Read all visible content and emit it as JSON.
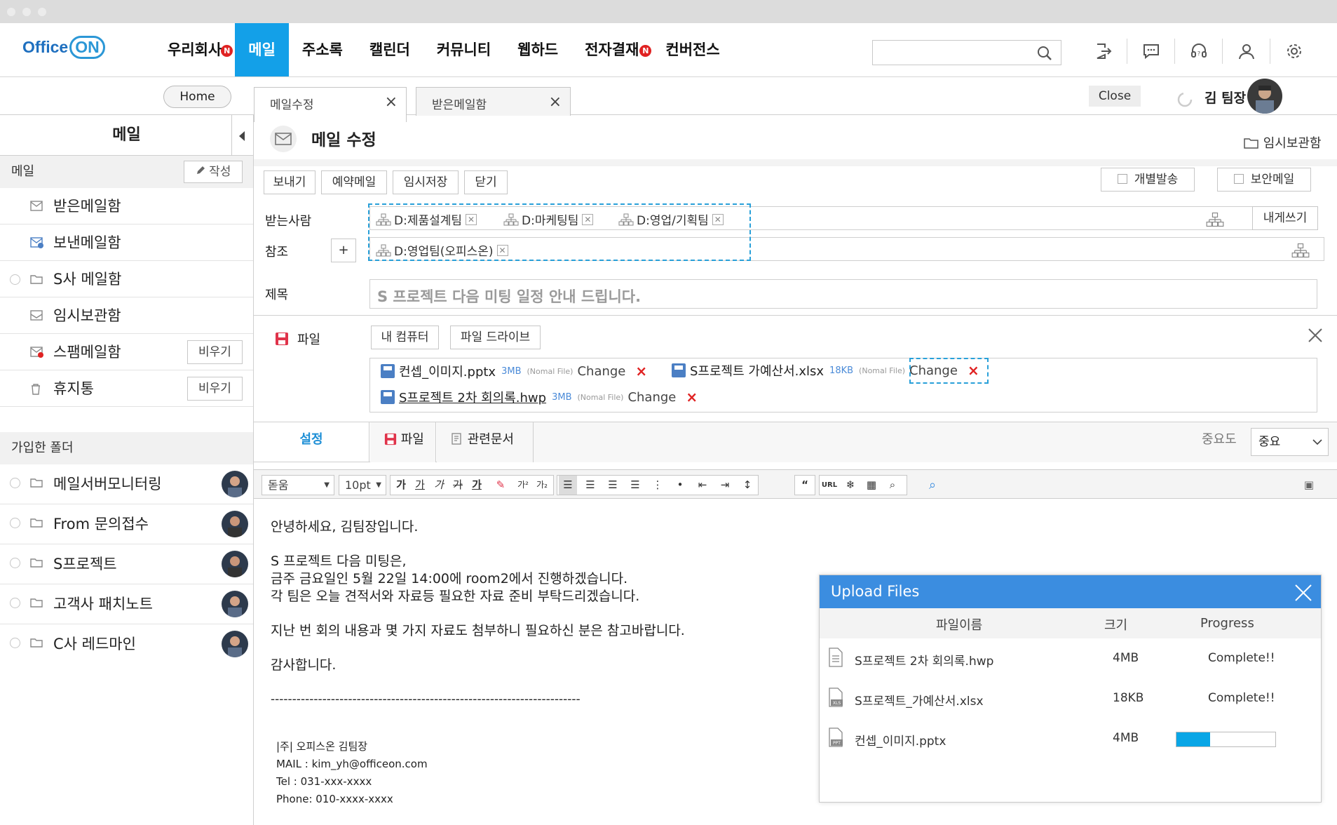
{
  "app": {
    "logo_text": "Office",
    "logo_on": "ON",
    "menu": [
      {
        "label": "우리회사",
        "badge": "N"
      },
      {
        "label": "메일",
        "active": true
      },
      {
        "label": "주소록"
      },
      {
        "label": "캘린더"
      },
      {
        "label": "커뮤니티"
      },
      {
        "label": "웹하드"
      },
      {
        "label": "전자결재",
        "badge": "N"
      },
      {
        "label": "컨버전스"
      }
    ],
    "search_placeholder": "",
    "accent_color": "#13a0e8"
  },
  "subbar": {
    "home_label": "Home",
    "tabs": [
      {
        "label": "메일수정",
        "close": "×"
      },
      {
        "label": "받은메일함",
        "close": "×"
      }
    ],
    "close_label": "Close",
    "username": "김 팀장"
  },
  "sidebar": {
    "title": "메일",
    "section_mail": "메일",
    "write_label": "작성",
    "items": [
      {
        "label": "받은메일함"
      },
      {
        "label": "보낸메일함"
      },
      {
        "label": "S사 메일함"
      },
      {
        "label": "임시보관함"
      },
      {
        "label": "스팸메일함",
        "action": "비우기"
      },
      {
        "label": "휴지통",
        "action": "비우기"
      }
    ],
    "section_joined": "가입한 폴더",
    "joined": [
      {
        "label": "메일서버모니터링"
      },
      {
        "label": "From 문의접수"
      },
      {
        "label": "S프로젝트"
      },
      {
        "label": "고객사 패치노트"
      },
      {
        "label": "C사 레드마인"
      }
    ]
  },
  "compose": {
    "title": "메일 수정",
    "temp_folder": "임시보관함",
    "buttons": {
      "send": "보내기",
      "reserve": "예약메일",
      "save": "임시저장",
      "close": "닫기"
    },
    "options": {
      "individual": "개별발송",
      "secure": "보안메일"
    },
    "to_label": "받는사람",
    "cc_label": "참조",
    "cc_add": "+",
    "to_self": "내게쓰기",
    "recipients": [
      "D:제품설계팀",
      "D:마케팅팀",
      "D:영업/기획팀"
    ],
    "cc": [
      "D:영업팀(오피스온)"
    ],
    "subject_label": "제목",
    "subject": "S 프로젝트 다음 미팅 일정 안내 드립니다.",
    "file_label": "파일",
    "my_computer": "내 컴퓨터",
    "file_drive": "파일 드라이브",
    "attachments": [
      {
        "name": "컨셉_이미지.pptx",
        "size": "3MB",
        "type": "(Nomal File)",
        "change": "Change",
        "delete": "×"
      },
      {
        "name": "S프로젝트 가예산서.xlsx",
        "size": "18KB",
        "type": "(Nomal File)",
        "change": "Change",
        "delete": "×"
      },
      {
        "name": "S프로젝트 2차 회의록.hwp",
        "size": "3MB",
        "type": "(Nomal File)",
        "change": "Change",
        "delete": "×"
      }
    ],
    "tabs": {
      "settings": "설정",
      "file": "파일",
      "related": "관련문서"
    },
    "importance_label": "중요도",
    "importance_value": "중요",
    "editor": {
      "font": "돋움",
      "size": "10pt",
      "url": "URL"
    },
    "body": [
      "안녕하세요, 김팀장입니다.",
      "",
      "S 프로젝트 다음 미팅은,",
      "금주 금요일인 5월 22일 14:00에 room2에서 진행하겠습니다.",
      "각 팀은 오늘 견적서와 자료등 필요한 자료 준비 부탁드리겠습니다.",
      "",
      "지난 번 회의 내용과 몇 가지 자료도 첨부하니 필요하신 분은 참고바랍니다.",
      "",
      "감사합니다.",
      "",
      "------------------------------------------------------------------------"
    ],
    "signature": [
      "|주| 오피스온 김팀장",
      "MAIL : kim_yh@officeon.com",
      "Tel : 031-xxx-xxxx",
      "Phone: 010-xxxx-xxxx"
    ]
  },
  "upload": {
    "title": "Upload Files",
    "col_name": "파일이름",
    "col_size": "크기",
    "col_progress": "Progress",
    "files": [
      {
        "name": "S프로젝트 2차 회의록.hwp",
        "size": "4MB",
        "status": "Complete!!"
      },
      {
        "name": "S프로젝트_가예산서.xlsx",
        "size": "18KB",
        "status": "Complete!!"
      },
      {
        "name": "컨셉_이미지.pptx",
        "size": "4MB",
        "status": "",
        "progress": 0.34
      }
    ]
  }
}
